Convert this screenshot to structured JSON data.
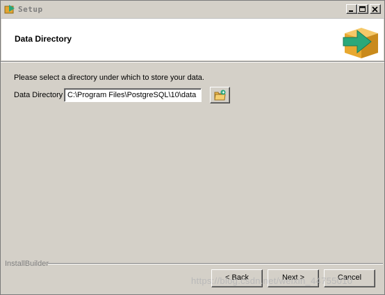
{
  "window": {
    "title": "Setup"
  },
  "header": {
    "title": "Data Directory"
  },
  "main": {
    "prompt": "Please select a directory under which to store your data.",
    "directory_label": "Data Directory",
    "directory_value": "C:\\Program Files\\PostgreSQL\\10\\data"
  },
  "footer": {
    "brand": "InstallBuilder",
    "back_label": "< Back",
    "next_label": "Next >",
    "cancel_label": "Cancel"
  },
  "watermark": "https://blog.csdn.net/weixin_44755010",
  "icons": {
    "app": "installer-icon",
    "minimize": "minimize-icon",
    "maximize": "maximize-icon",
    "close": "close-icon",
    "logo": "box-arrow-icon",
    "browse": "folder-icon"
  },
  "colors": {
    "logo_box": "#f0b030",
    "logo_arrow": "#2aa87a"
  }
}
